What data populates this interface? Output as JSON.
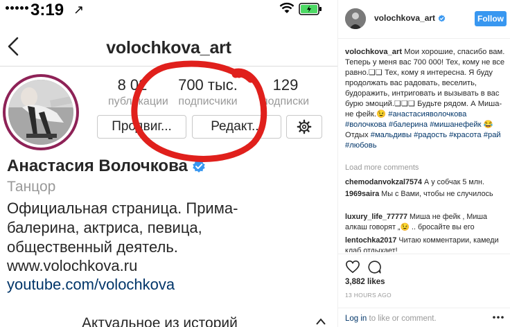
{
  "status_bar": {
    "time": "3:19",
    "location_glyph": "↗"
  },
  "profile": {
    "username": "volochkova_art",
    "stats": [
      {
        "value": "8 02",
        "label": "публикации"
      },
      {
        "value": "700 тыс.",
        "label": "подписчики"
      },
      {
        "value": "129",
        "label": "подписки"
      }
    ],
    "buttons": {
      "promote": "Продвиг...",
      "edit": "Редакт..."
    },
    "full_name": "Анастасия Волочкова",
    "category": "Танцор",
    "bio_lines": [
      "Официальная страница. Прима-",
      "балерина, актриса, певица,",
      "общественный деятель."
    ],
    "links": [
      "www.volochkova.ru",
      "youtube.com/volochkova"
    ],
    "highlights_title": "Актуальное из историй"
  },
  "post": {
    "username": "volochkova_art",
    "follow_label": "Follow",
    "caption_text": "Мои хорошие, спасибо вам. Теперь у меня вас 700 000! Тех, кому не все равно.❏❏ Тех, кому я интересна. Я буду продолжать вас радовать, веселить, будоражить, интриговать и вызывать в вас бурю эмоций.❏❏❏ Будьте рядом. А Миша-не фейк.😉 ",
    "hashtags_1": "#анастасияволочкова #волочкова #балерина #мишанефейк",
    "caption_mid": "😂 Отдых ",
    "hashtags_2": "#мальдивы #радость #красота #рай #любовь",
    "load_more": "Load more comments",
    "comments": [
      {
        "user": "chemodanvokzal7574",
        "text": "А у собчак 5 млн."
      },
      {
        "user": "1969saira",
        "text": "Мы с Вами, чтобы не случилось"
      },
      {
        "user": "luxury_life_77777",
        "text": "Миша не фейк , Миша алкаш говорят „😉 .. бросайте вы его"
      },
      {
        "user": "lentochka2017",
        "text": "Читаю комментарии, камеди клаб отдыхает!"
      }
    ],
    "likes": "3,882 likes",
    "time_ago": "13 HOURS AGO",
    "login_link": "Log in",
    "login_suffix": "to like or comment."
  },
  "colors": {
    "accent_blue": "#3897f0",
    "link_blue": "#003569",
    "annotation_red": "#e0201c",
    "avatar_ring": "#8e2257"
  },
  "icons": [
    "signal-icon",
    "location-arrow-icon",
    "wifi-icon",
    "battery-icon",
    "back-chevron-icon",
    "verified-badge-icon",
    "gear-icon",
    "heart-icon",
    "comment-bubble-icon",
    "more-options-icon"
  ]
}
